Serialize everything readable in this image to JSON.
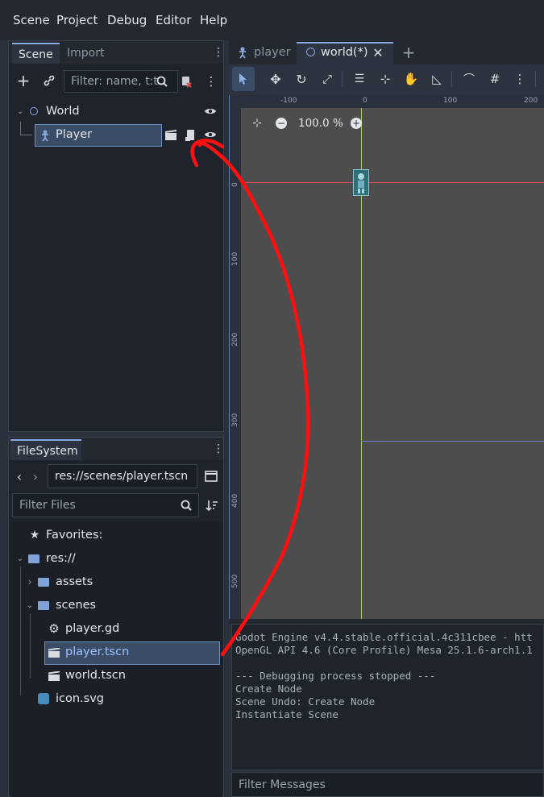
{
  "menu": [
    "Scene",
    "Project",
    "Debug",
    "Editor",
    "Help"
  ],
  "scene_dock": {
    "tabs": [
      "Scene",
      "Import"
    ],
    "filter_placeholder": "Filter: name, t:t",
    "tree": [
      {
        "label": "World",
        "type": "node2d"
      },
      {
        "label": "Player",
        "type": "character"
      }
    ]
  },
  "filesystem_dock": {
    "tab": "FileSystem",
    "path": "res://scenes/player.tscn",
    "filter_placeholder": "Filter Files",
    "items": [
      {
        "label": "Favorites:",
        "icon": "star-icon"
      },
      {
        "label": "res://",
        "icon": "folder-icon"
      },
      {
        "label": "assets",
        "icon": "folder-icon"
      },
      {
        "label": "scenes",
        "icon": "folder-icon"
      },
      {
        "label": "player.gd",
        "icon": "gear-icon"
      },
      {
        "label": "player.tscn",
        "icon": "clapper-icon"
      },
      {
        "label": "world.tscn",
        "icon": "clapper-icon"
      },
      {
        "label": "icon.svg",
        "icon": "image-icon"
      }
    ]
  },
  "editor_tabs": [
    {
      "label": "player"
    },
    {
      "label": "world(*)"
    }
  ],
  "viewport": {
    "zoom": "100.0 %",
    "ruler_h": [
      "-100",
      "0",
      "100",
      "200"
    ],
    "ruler_v": [
      "0",
      "100",
      "200",
      "300",
      "400",
      "500"
    ]
  },
  "output": {
    "lines": [
      "Godot Engine v4.4.stable.official.4c311cbee - htt",
      "OpenGL API 4.6 (Core Profile) Mesa 25.1.6-arch1.1",
      "",
      "--- Debugging process stopped ---",
      "Create Node",
      "Scene Undo: Create Node",
      "Instantiate Scene"
    ],
    "filter_placeholder": "Filter Messages"
  }
}
